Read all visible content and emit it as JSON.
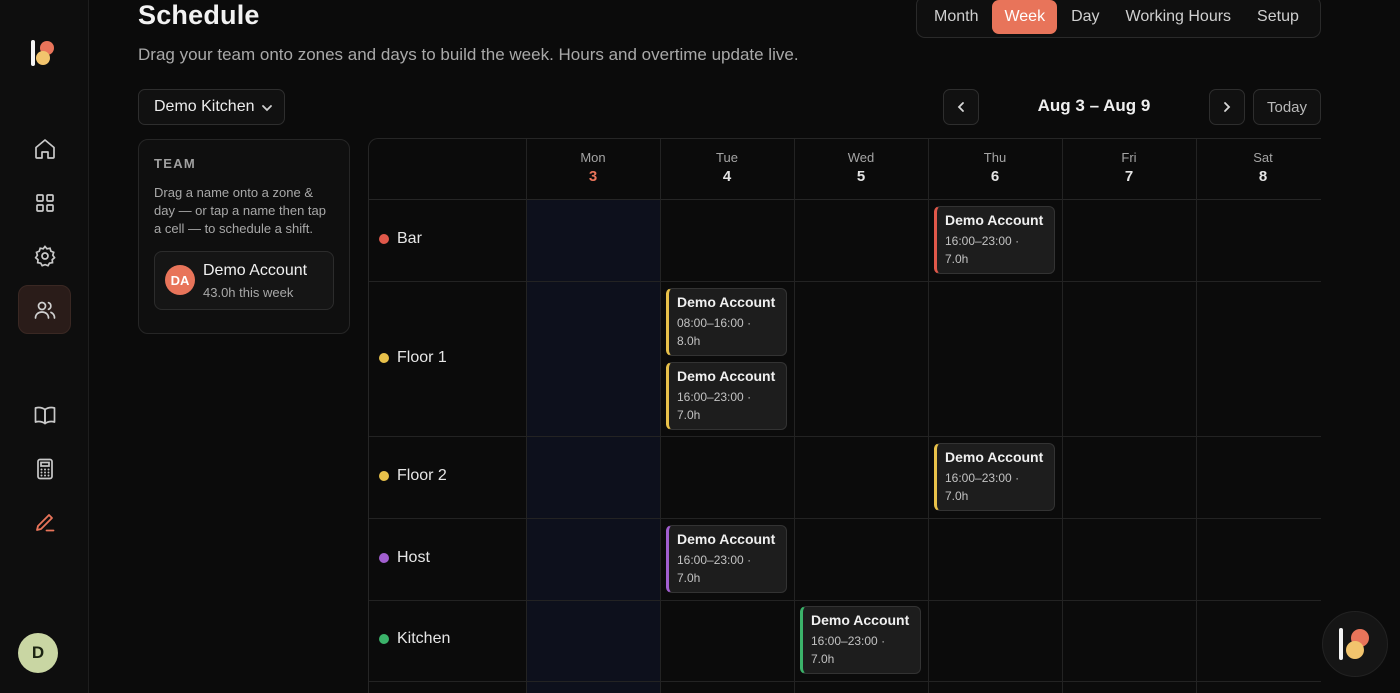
{
  "header": {
    "title": "Schedule",
    "subtitle": "Drag your team onto zones and days to build the week. Hours and overtime update live."
  },
  "view_tabs": [
    "Month",
    "Week",
    "Day",
    "Working Hours",
    "Setup"
  ],
  "active_view": "Week",
  "location": "Demo Kitchen",
  "week_range": "Aug 3 – Aug 9",
  "today_label": "Today",
  "user_initial": "D",
  "team": {
    "heading": "TEAM",
    "hint": "Drag a name onto a zone & day — or tap a name then tap a cell — to schedule a shift.",
    "members": [
      {
        "initials": "DA",
        "name": "Demo Account",
        "hours": "43.0h this week"
      }
    ]
  },
  "days": [
    {
      "name": "Mon",
      "num": "3"
    },
    {
      "name": "Tue",
      "num": "4"
    },
    {
      "name": "Wed",
      "num": "5"
    },
    {
      "name": "Thu",
      "num": "6"
    },
    {
      "name": "Fri",
      "num": "7"
    },
    {
      "name": "Sat",
      "num": "8"
    }
  ],
  "zones": [
    {
      "name": "Bar",
      "color": "#e0584a"
    },
    {
      "name": "Floor 1",
      "color": "#e8c14a"
    },
    {
      "name": "Floor 2",
      "color": "#e8c14a"
    },
    {
      "name": "Host",
      "color": "#a25fd0"
    },
    {
      "name": "Kitchen",
      "color": "#3bb36a"
    }
  ],
  "shifts": [
    {
      "zone": "Bar",
      "day": "Thu",
      "name": "Demo Account",
      "time": "16:00–23:00 ·",
      "hours": "7.0h",
      "color": "#e0584a"
    },
    {
      "zone": "Floor 1",
      "day": "Tue",
      "name": "Demo Account",
      "time": "08:00–16:00 ·",
      "hours": "8.0h",
      "color": "#e8c14a"
    },
    {
      "zone": "Floor 1",
      "day": "Tue",
      "name": "Demo Account",
      "time": "16:00–23:00 ·",
      "hours": "7.0h",
      "color": "#e8c14a"
    },
    {
      "zone": "Floor 2",
      "day": "Thu",
      "name": "Demo Account",
      "time": "16:00–23:00 ·",
      "hours": "7.0h",
      "color": "#e8c14a"
    },
    {
      "zone": "Host",
      "day": "Tue",
      "name": "Demo Account",
      "time": "16:00–23:00 ·",
      "hours": "7.0h",
      "color": "#a25fd0"
    },
    {
      "zone": "Kitchen",
      "day": "Wed",
      "name": "Demo Account",
      "time": "16:00–23:00 ·",
      "hours": "7.0h",
      "color": "#3bb36a"
    }
  ]
}
